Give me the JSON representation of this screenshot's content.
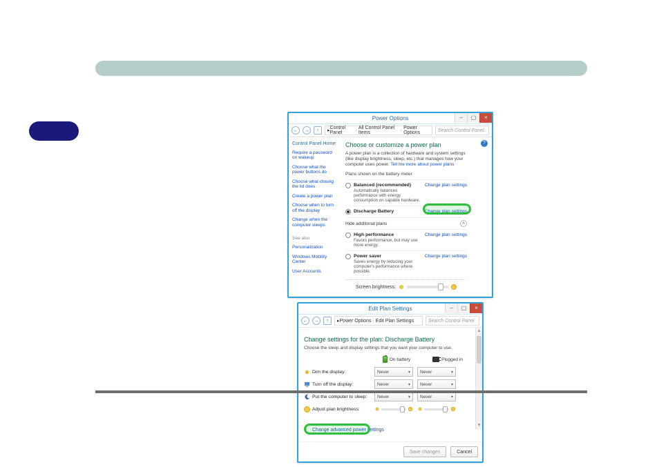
{
  "win1": {
    "title": "Power Options",
    "close": "×",
    "max": "▢",
    "min": "–",
    "nav": {
      "back": "←",
      "fwd": "→",
      "up": "↑"
    },
    "crumbs": [
      "Control Panel",
      "All Control Panel Items",
      "Power Options"
    ],
    "search_placeholder": "Search Control Panel",
    "help": "?",
    "sidebar": {
      "head": "Control Panel Home",
      "items": [
        "Require a password on wakeup",
        "Choose what the power buttons do",
        "Choose what closing the lid does",
        "Create a power plan",
        "Choose when to turn off the display",
        "Change when the computer sleeps"
      ],
      "see_also": "See also",
      "see_items": [
        "Personalization",
        "Windows Mobility Center",
        "User Accounts"
      ]
    },
    "main": {
      "title": "Choose or customize a power plan",
      "desc_a": "A power plan is a collection of hardware and system settings (like display brightness, sleep, etc.) that manages how your computer uses power. ",
      "desc_link": "Tell me more about power plans",
      "sub1": "Plans shown on the battery meter",
      "plans_meter": [
        {
          "name": "Balanced (recommended)",
          "desc": "Automatically balances performance with energy consumption on capable hardware.",
          "checked": false,
          "change": "Change plan settings"
        },
        {
          "name": "Discharge Battery",
          "desc": "",
          "checked": true,
          "change": "Change plan settings"
        }
      ],
      "sub2": "Hide additional plans",
      "toggle": "˄",
      "plans_more": [
        {
          "name": "High performance",
          "desc": "Favors performance, but may use more energy.",
          "checked": false,
          "change": "Change plan settings"
        },
        {
          "name": "Power saver",
          "desc": "Saves energy by reducing your computer's performance where possible.",
          "checked": false,
          "change": "Change plan settings"
        }
      ],
      "brightness_label": "Screen brightness:"
    }
  },
  "win2": {
    "title": "Edit Plan Settings",
    "crumbs": [
      "Power Options",
      "Edit Plan Settings"
    ],
    "search_placeholder": "Search Control Panel",
    "heading": "Change settings for the plan: Discharge Battery",
    "sub": "Choose the sleep and display settings that you want your computer to use.",
    "col_battery": "On battery",
    "col_plugged": "Plugged in",
    "rows": [
      {
        "label": "Dim the display:",
        "batt": "Never",
        "plug": "Never"
      },
      {
        "label": "Turn off the display:",
        "batt": "Never",
        "plug": "Never"
      },
      {
        "label": "Put the computer to sleep:",
        "batt": "Never",
        "plug": "Never"
      }
    ],
    "brightness_label": "Adjust plan brightness:",
    "adv_link": "Change advanced power settings",
    "save_btn": "Save changes",
    "cancel_btn": "Cancel"
  }
}
